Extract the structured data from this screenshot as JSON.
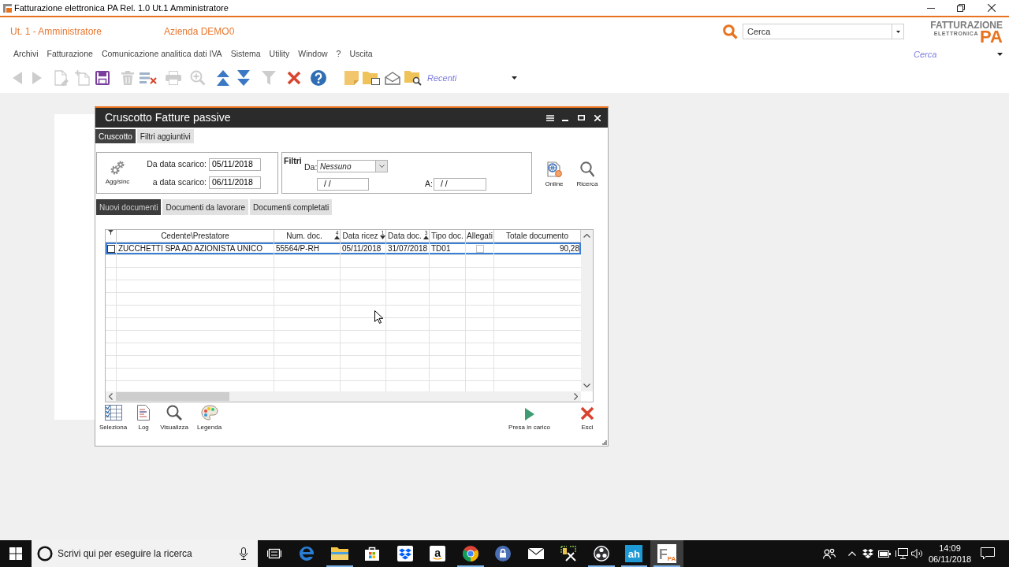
{
  "window": {
    "title": "Fatturazione elettronica PA Rel. 1.0 Ut.1 Amministratore"
  },
  "header": {
    "user": "Ut. 1 - Amministratore",
    "company": "Azienda DEMO0",
    "search": {
      "value": "Cerca"
    },
    "logo": {
      "title": "FATTURAZIONE",
      "subtitle": "ELETTRONICA",
      "badge": "PA"
    }
  },
  "menu": [
    "Archivi",
    "Fatturazione",
    "Comunicazione analitica dati IVA",
    "Sistema",
    "Utility",
    "Window",
    "?",
    "Uscita"
  ],
  "quick_search": {
    "placeholder": "Cerca"
  },
  "toolbar": {
    "buttons": [
      {
        "kind": "back",
        "disabled": true
      },
      {
        "kind": "forward",
        "disabled": true
      },
      {
        "kind": "new",
        "disabled": true
      },
      {
        "kind": "add",
        "disabled": true
      },
      {
        "kind": "save",
        "disabled": false
      },
      {
        "kind": "trash",
        "disabled": true
      },
      {
        "kind": "delete-rows",
        "disabled": false
      },
      {
        "kind": "print",
        "disabled": true
      },
      {
        "kind": "zoom",
        "disabled": true
      },
      {
        "kind": "up",
        "disabled": false
      },
      {
        "kind": "down",
        "disabled": false
      },
      {
        "kind": "filter",
        "disabled": true
      },
      {
        "kind": "cancel",
        "disabled": false
      },
      {
        "kind": "help",
        "disabled": false
      },
      {
        "kind": "note",
        "disabled": false
      },
      {
        "kind": "folder",
        "disabled": false
      },
      {
        "kind": "envelope",
        "disabled": false
      },
      {
        "kind": "folder-search",
        "disabled": false
      }
    ],
    "recent": {
      "placeholder": "Recenti"
    }
  },
  "dialog": {
    "title": "Cruscotto Fatture passive",
    "tabs": [
      {
        "label": "Cruscotto",
        "selected": true
      },
      {
        "label": "Filtri aggiuntivi",
        "selected": false
      }
    ],
    "download": {
      "button": "Agg/sinc",
      "from": {
        "label": "Da data scarico:",
        "value": "05/11/2018"
      },
      "to": {
        "label": "a data scarico:",
        "value": "06/11/2018"
      }
    },
    "filters": {
      "title": "Filtri",
      "from_label": "Da:",
      "from_value": "Nessuno",
      "date_from": "/ /",
      "to_label": "A:",
      "date_to": "/ /"
    },
    "tools": [
      {
        "kind": "online",
        "label": "Online"
      },
      {
        "kind": "search",
        "label": "Ricerca"
      }
    ],
    "doc_tabs": [
      {
        "label": "Nuovi documenti",
        "selected": true
      },
      {
        "label": "Documenti da lavorare",
        "selected": false
      },
      {
        "label": "Documenti completati",
        "selected": false
      }
    ],
    "table": {
      "columns": [
        {
          "label": "Cedente\\Prestatore"
        },
        {
          "label": "Num. doc.",
          "sort_order": "4",
          "descending": false
        },
        {
          "label": "Data ricez",
          "sort_order": "1",
          "descending": true
        },
        {
          "label": "Data doc.",
          "sort_order": "3",
          "descending": false
        },
        {
          "label": "Tipo doc."
        },
        {
          "label": "Allegati"
        },
        {
          "label": "Totale documento"
        }
      ],
      "rows": [
        {
          "selected": true,
          "checked": false,
          "cells": [
            "ZUCCHETTI SPA AD AZIONISTA UNICO",
            "55564/P-RH",
            "05/11/2018",
            "31/07/2018",
            "TD01"
          ],
          "attachments": false,
          "total": "90,28"
        }
      ]
    },
    "actions": [
      {
        "kind": "select",
        "label": "Seleziona"
      },
      {
        "kind": "log",
        "label": "Log"
      },
      {
        "kind": "view",
        "label": "Visualizza"
      },
      {
        "kind": "legend",
        "label": "Legenda"
      }
    ],
    "main_actions": [
      {
        "kind": "take",
        "label": "Presa in carico"
      },
      {
        "kind": "exit",
        "label": "Esci"
      }
    ]
  },
  "taskbar": {
    "search": {
      "placeholder": "Scrivi qui per eseguire la ricerca"
    },
    "apps": [
      {
        "kind": "task-view",
        "running": false,
        "active": false
      },
      {
        "kind": "edge",
        "running": false,
        "active": false
      },
      {
        "kind": "explorer",
        "running": true,
        "active": false
      },
      {
        "kind": "store",
        "running": false,
        "active": false
      },
      {
        "kind": "dropbox",
        "running": false,
        "active": false
      },
      {
        "kind": "amazon",
        "label": "a",
        "running": false,
        "active": false
      },
      {
        "kind": "chrome",
        "running": true,
        "active": false
      },
      {
        "kind": "lock",
        "running": false,
        "active": false
      },
      {
        "kind": "mail",
        "running": false,
        "active": false
      },
      {
        "kind": "tools",
        "running": false,
        "active": false
      },
      {
        "kind": "obs",
        "running": true,
        "active": false
      },
      {
        "kind": "ah",
        "label": "ah",
        "running": true,
        "active": false
      },
      {
        "kind": "fpa",
        "letter": "F",
        "label": "PA",
        "running": true,
        "active": true
      }
    ],
    "clock": {
      "time": "14:09",
      "date": "06/11/2018"
    }
  }
}
